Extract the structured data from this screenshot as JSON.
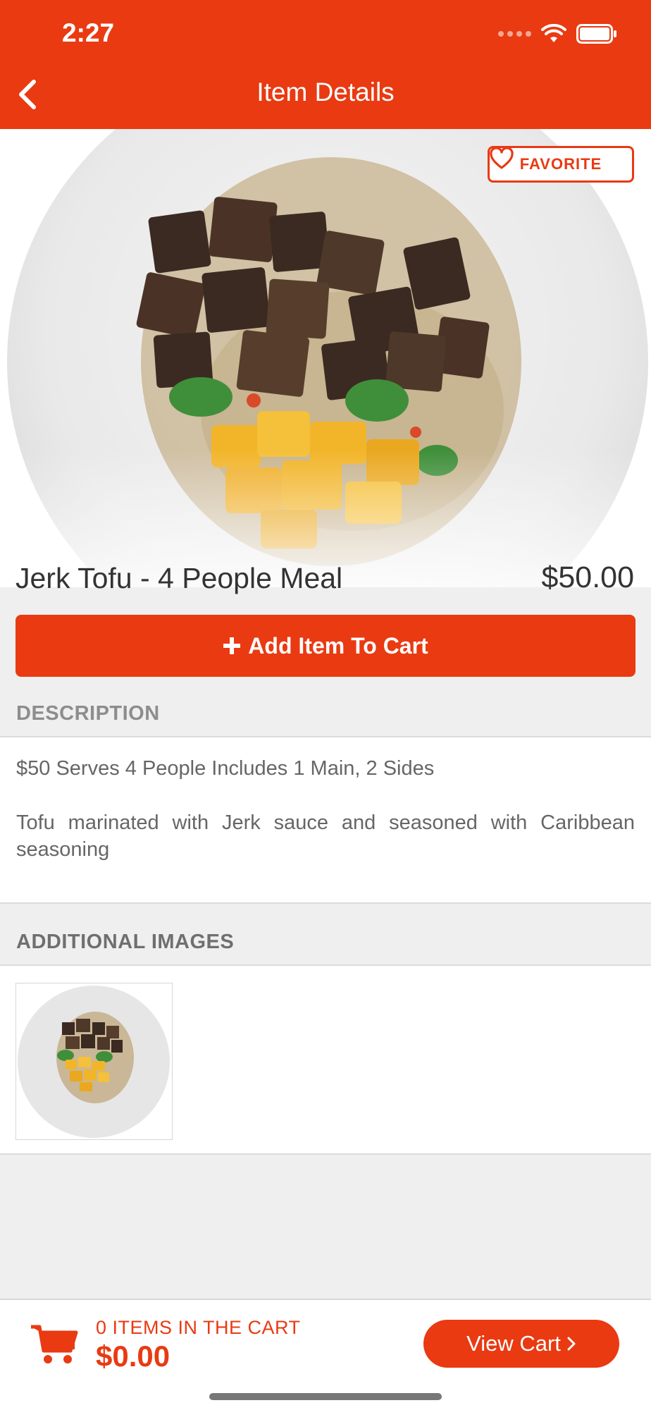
{
  "status_bar": {
    "time": "2:27"
  },
  "header": {
    "title": "Item Details"
  },
  "hero": {
    "favorite_label": "FAVORITE"
  },
  "item": {
    "name": "Jerk Tofu - 4 People Meal",
    "price": "$50.00"
  },
  "add_to_cart": {
    "label": "Add Item To Cart"
  },
  "description": {
    "heading": "DESCRIPTION",
    "line1": "$50 Serves 4 People Includes 1 Main, 2 Sides",
    "line2": "Tofu marinated with Jerk sauce and seasoned with Caribbean seasoning"
  },
  "additional_images": {
    "heading": "ADDITIONAL IMAGES"
  },
  "footer": {
    "items_count": "0 ITEMS IN THE CART",
    "total": "$0.00",
    "view_cart_label": "View Cart"
  },
  "colors": {
    "accent": "#e93a12",
    "page_bg": "#efefef"
  }
}
